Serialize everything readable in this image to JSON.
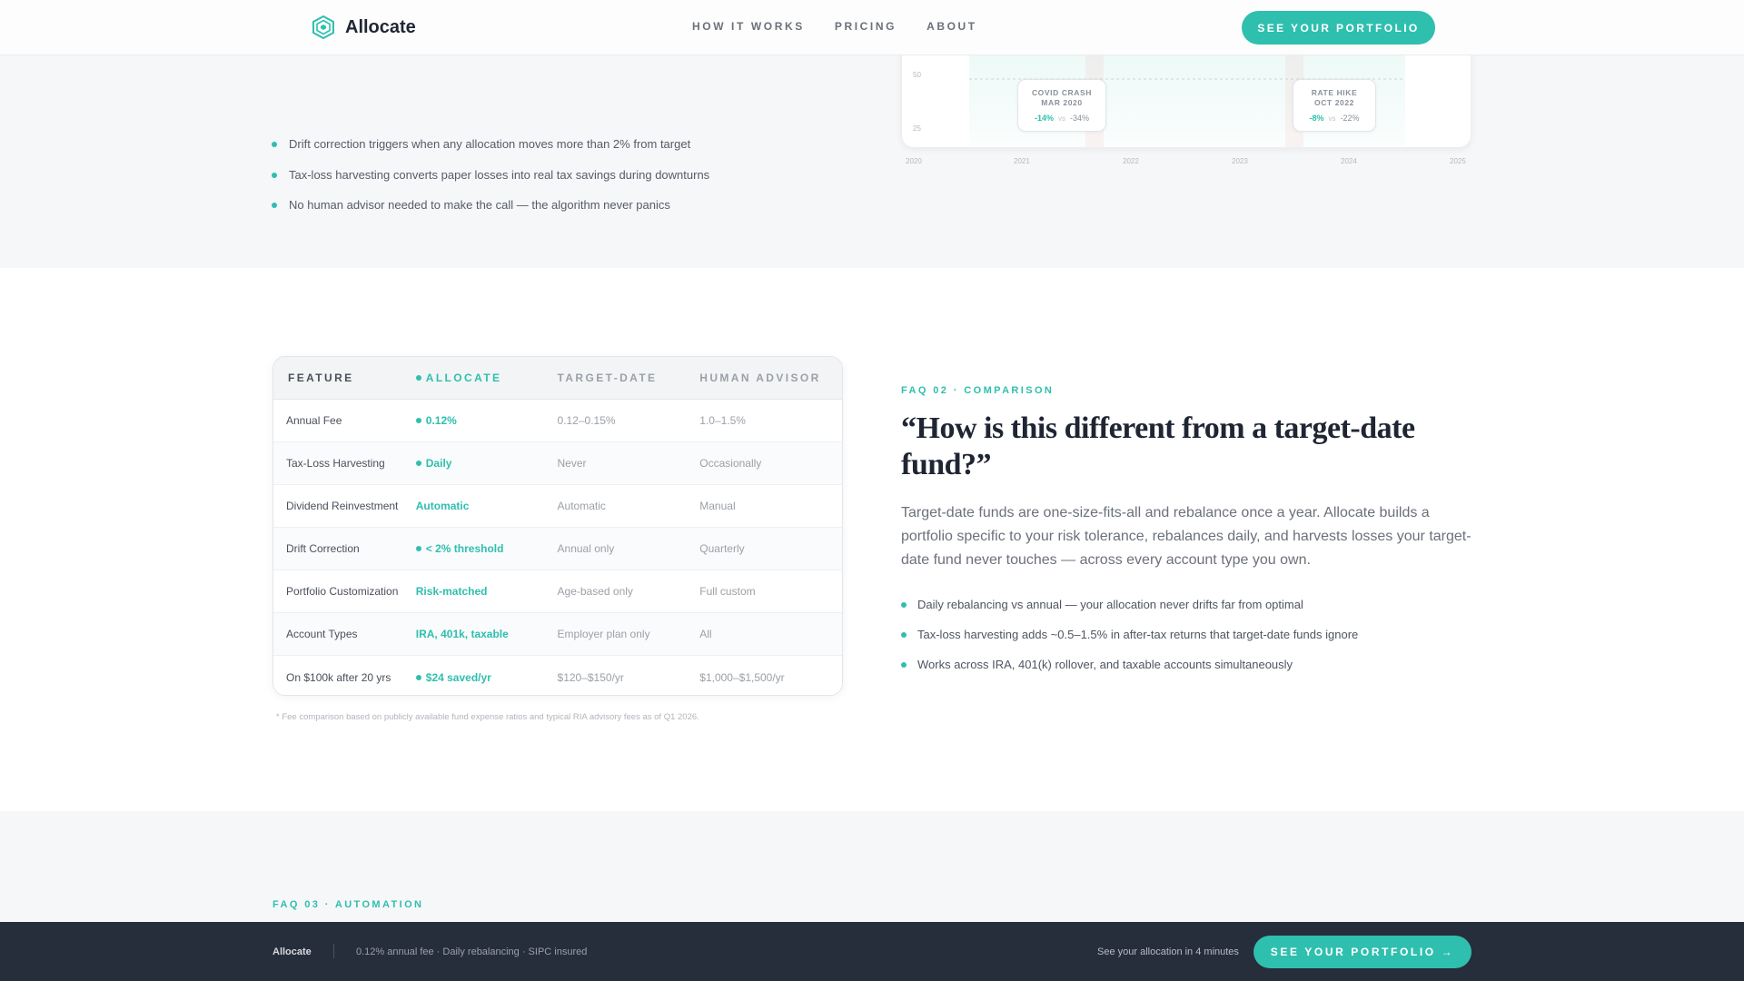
{
  "nav": {
    "brand": "Allocate",
    "links": [
      "HOW IT WORKS",
      "PRICING",
      "ABOUT"
    ],
    "cta": "SEE YOUR PORTFOLIO"
  },
  "section1": {
    "bullets": [
      "Drift correction triggers when any allocation moves more than 2% from target",
      "Tax-loss harvesting converts paper losses into real tax savings during downturns",
      "No human advisor needed to make the call — the algorithm never panics"
    ],
    "chart": {
      "y_labels": [
        "50",
        "25"
      ],
      "x_labels": [
        "2020",
        "2021",
        "2022",
        "2023",
        "2024",
        "2025"
      ],
      "events": [
        {
          "title_line1": "COVID CRASH",
          "title_line2": "MAR 2020",
          "allocate": "-14%",
          "vs": "vs",
          "other": "-34%"
        },
        {
          "title_line1": "RATE HIKE",
          "title_line2": "OCT 2022",
          "allocate": "-8%",
          "vs": "vs",
          "other": "-22%"
        }
      ]
    }
  },
  "comparison": {
    "headers": [
      "FEATURE",
      "ALLOCATE",
      "TARGET-DATE",
      "HUMAN ADVISOR"
    ],
    "rows": [
      {
        "feature": "Annual Fee",
        "allocate": "0.12%",
        "dot": true,
        "target_date": "0.12–0.15%",
        "human": "1.0–1.5%"
      },
      {
        "feature": "Tax-Loss Harvesting",
        "allocate": "Daily",
        "dot": true,
        "target_date": "Never",
        "human": "Occasionally"
      },
      {
        "feature": "Dividend Reinvestment",
        "allocate": "Automatic",
        "dot": false,
        "target_date": "Automatic",
        "human": "Manual"
      },
      {
        "feature": "Drift Correction",
        "allocate": "< 2% threshold",
        "dot": true,
        "target_date": "Annual only",
        "human": "Quarterly"
      },
      {
        "feature": "Portfolio Customization",
        "allocate": "Risk-matched",
        "dot": false,
        "target_date": "Age-based only",
        "human": "Full custom"
      },
      {
        "feature": "Account Types",
        "allocate": "IRA, 401k, taxable",
        "dot": false,
        "target_date": "Employer plan only",
        "human": "All"
      },
      {
        "feature": "On $100k after 20 yrs",
        "allocate": "$24 saved/yr",
        "dot": true,
        "target_date": "$120–$150/yr",
        "human": "$1,000–$1,500/yr"
      }
    ],
    "footnote": "* Fee comparison based on publicly available fund expense ratios and typical RIA advisory fees as of Q1 2026."
  },
  "faq2": {
    "eyebrow": "FAQ 02 · COMPARISON",
    "title": "“How is this different from a target-date fund?”",
    "body": "Target-date funds are one-size-fits-all and rebalance once a year. Allocate builds a portfolio specific to your risk tolerance, rebalances daily, and harvests losses your target-date fund never touches — across every account type you own.",
    "bullets": [
      "Daily rebalancing vs annual — your allocation never drifts far from optimal",
      "Tax-loss harvesting adds ~0.5–1.5% in after-tax returns that target-date funds ignore",
      "Works across IRA, 401(k) rollover, and taxable accounts simultaneously"
    ]
  },
  "faq3": {
    "eyebrow": "FAQ 03 · AUTOMATION"
  },
  "footer_bar": {
    "brand": "Allocate",
    "info": "0.12% annual fee · Daily rebalancing · SIPC insured",
    "note": "See your allocation in 4 minutes",
    "cta": "SEE YOUR PORTFOLIO →"
  },
  "colors": {
    "accent": "#2fbfae",
    "dark_bar": "#262d3b",
    "heading": "#1f2533"
  }
}
